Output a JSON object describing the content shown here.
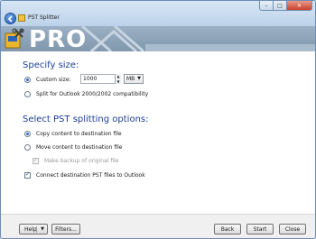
{
  "window": {
    "title": "PST Splitter",
    "brand_text": "PRO"
  },
  "size_section": {
    "heading": "Specify size:",
    "custom_size_label": "Custom size:",
    "custom_size_value": "1000",
    "unit_selected": "MB",
    "compat_label": "Split for Outlook 2000/2002 compatibility"
  },
  "options_section": {
    "heading": "Select PST splitting options:",
    "copy_label": "Copy content to destination file",
    "move_label": "Move content to destination file",
    "backup_label": "Make backup of original file",
    "connect_label": "Connect destination PST files to Outlook"
  },
  "footer": {
    "help_label": "Help",
    "filters_label": "Filters...",
    "back_label": "Back",
    "start_label": "Start",
    "close_label": "Close"
  },
  "colors": {
    "heading": "#1b3f96",
    "banner": "#8fa5ba"
  }
}
